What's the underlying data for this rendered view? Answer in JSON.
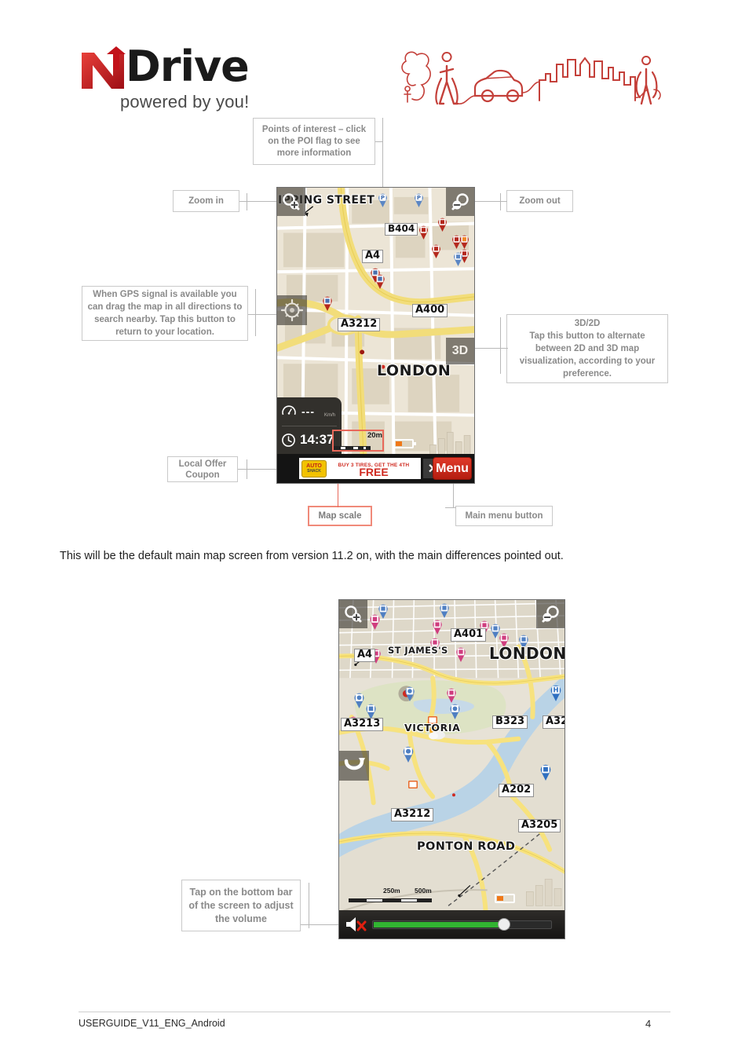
{
  "document": {
    "logo": {
      "brand_word": "Drive",
      "tagline": "powered by you!",
      "mark": "n-arrow-logo"
    },
    "header_art": "city-scene-line-art",
    "body_paragraph": "This will be the default main map screen from version 11.2 on, with the main differences pointed out.",
    "footer": {
      "file_label": "USERGUIDE_V11_ENG_Android",
      "page_number": "4"
    }
  },
  "callouts": {
    "poi": "Points of interest – click on the POI flag to see more information",
    "zoom_in": "Zoom in",
    "zoom_out": "Zoom out",
    "gps": "When GPS signal is available you can drag the map in all directions to search nearby. Tap this button to return to your location.",
    "three_d": "3D/2D\nTap this button to alternate between 2D and 3D map visualization, according to your preference.",
    "three_d_title": "3D/2D",
    "three_d_body": "Tap this button to alternate between 2D and 3D map visualization, according to your preference.",
    "local_offer": "Local Offer Coupon",
    "map_scale": "Map scale",
    "main_menu": "Main menu button",
    "volume": "Tap on the bottom bar of the screen to adjust the volume"
  },
  "screen1": {
    "top_street_label": "IPPING STREET",
    "zoom_in_icon": "magnifier-plus-icon",
    "zoom_out_icon": "magnifier-minus-icon",
    "compass_icon": "compass-locate-icon",
    "view_mode_button": "3D",
    "road_labels": [
      "B404",
      "A4",
      "A400",
      "A3212"
    ],
    "place_label": "LONDON",
    "dashboard": {
      "speed_value": "---",
      "speed_unit": "Km/h",
      "clock_value": "14:37",
      "speed_icon": "speedometer-icon",
      "clock_icon": "clock-icon"
    },
    "scale": {
      "value": "20m"
    },
    "battery_icon": "battery-icon",
    "ad": {
      "logo_line1": "AUTO",
      "logo_line2": "SHACK",
      "headline": "BUY 3 TIRES, GET THE 4TH",
      "emphasis": "FREE",
      "close_label": "✕"
    },
    "menu_button": "Menu"
  },
  "screen2": {
    "zoom_in_icon": "magnifier-plus-icon",
    "zoom_out_icon": "magnifier-minus-icon",
    "back_icon": "return-arrow-icon",
    "road_labels": [
      "A401",
      "A4",
      "A3213",
      "B323",
      "A32",
      "A202",
      "A3212",
      "A3205"
    ],
    "place_labels": [
      "ST JAMES'S",
      "LONDON",
      "VICTORIA",
      "PONTON ROAD"
    ],
    "scale": {
      "mid": "250m",
      "max": "500m"
    },
    "battery_icon": "battery-icon",
    "volume": {
      "mute_icon": "speaker-muted-icon",
      "level_percent": 72
    }
  },
  "colors": {
    "accent_red": "#cf2a20",
    "callout_border": "#c9c9c9",
    "callout_text": "#8a8a8a",
    "highlight_border": "#f08a7a",
    "volume_fill": "#32b432",
    "battery_fill": "#f07818"
  }
}
